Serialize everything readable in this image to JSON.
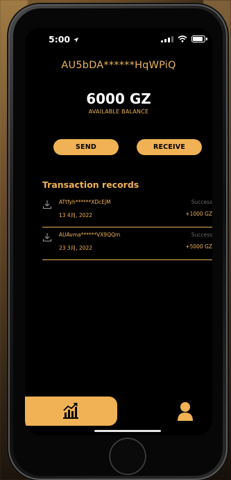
{
  "status_bar": {
    "time": "5:00"
  },
  "account": {
    "id_masked": "AU5bDA******HqWPiQ"
  },
  "balance": {
    "amount": "6000 GZ",
    "label": "AVAILABLE BALANCE"
  },
  "actions": {
    "send_label": "SEND",
    "receive_label": "RECEIVE"
  },
  "transactions": {
    "title": "Transaction records",
    "items": [
      {
        "address": "ATtfyh******XDcEjM",
        "date": "13 4月, 2022",
        "status": "Success",
        "amount": "+1000 GZ"
      },
      {
        "address": "AUAvma******VX9QQm",
        "date": "23 3月, 2022",
        "status": "Success",
        "amount": "+5000 GZ"
      }
    ]
  },
  "colors": {
    "accent": "#f0b255",
    "background": "#000000",
    "muted": "#6b6b6b"
  },
  "icons": {
    "status_location": "location-arrow-icon",
    "status_signal": "signal-icon",
    "status_wifi": "wifi-icon",
    "status_battery": "battery-icon",
    "transaction": "download-icon",
    "nav_home": "chart-icon",
    "nav_profile": "user-icon"
  }
}
